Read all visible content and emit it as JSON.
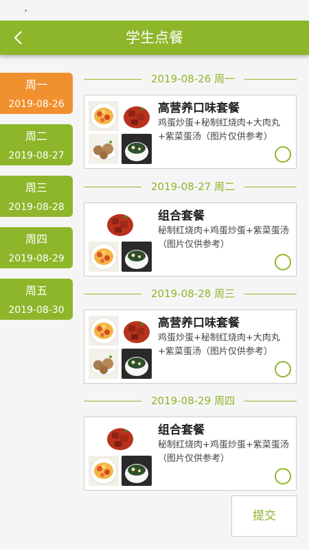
{
  "header": {
    "title": "学生点餐"
  },
  "days": [
    {
      "weekday": "周一",
      "date": "2019-08-26"
    },
    {
      "weekday": "周二",
      "date": "2019-08-27"
    },
    {
      "weekday": "周三",
      "date": "2019-08-28"
    },
    {
      "weekday": "周四",
      "date": "2019-08-29"
    },
    {
      "weekday": "周五",
      "date": "2019-08-30"
    }
  ],
  "selected_day": "周一",
  "sections": [
    {
      "heading": "2019-08-26 周一",
      "meal_name": "高营养口味套餐",
      "meal_desc": "鸡蛋炒蛋+秘制红烧肉+大肉丸+紫菜蛋汤（图片仅供参考）",
      "checked": false
    },
    {
      "heading": "2019-08-27 周二",
      "meal_name": "组合套餐",
      "meal_desc": "秘制红烧肉+鸡蛋炒蛋+紫菜蛋汤（图片仅供参考）",
      "checked": false
    },
    {
      "heading": "2019-08-28 周三",
      "meal_name": "高营养口味套餐",
      "meal_desc": "鸡蛋炒蛋+秘制红烧肉+大肉丸+紫菜蛋汤（图片仅供参考）",
      "checked": false
    },
    {
      "heading": "2019-08-29 周四",
      "meal_name": "组合套餐",
      "meal_desc": "秘制红烧肉+鸡蛋炒蛋+紫菜蛋汤（图片仅供参考）",
      "checked": false
    }
  ],
  "submit_label": "提交",
  "colors": {
    "primary_green": "#8db62a",
    "active_orange": "#f0902f"
  },
  "icons": {
    "back": "chevron-left-icon",
    "select": "radio-circle-icon"
  }
}
